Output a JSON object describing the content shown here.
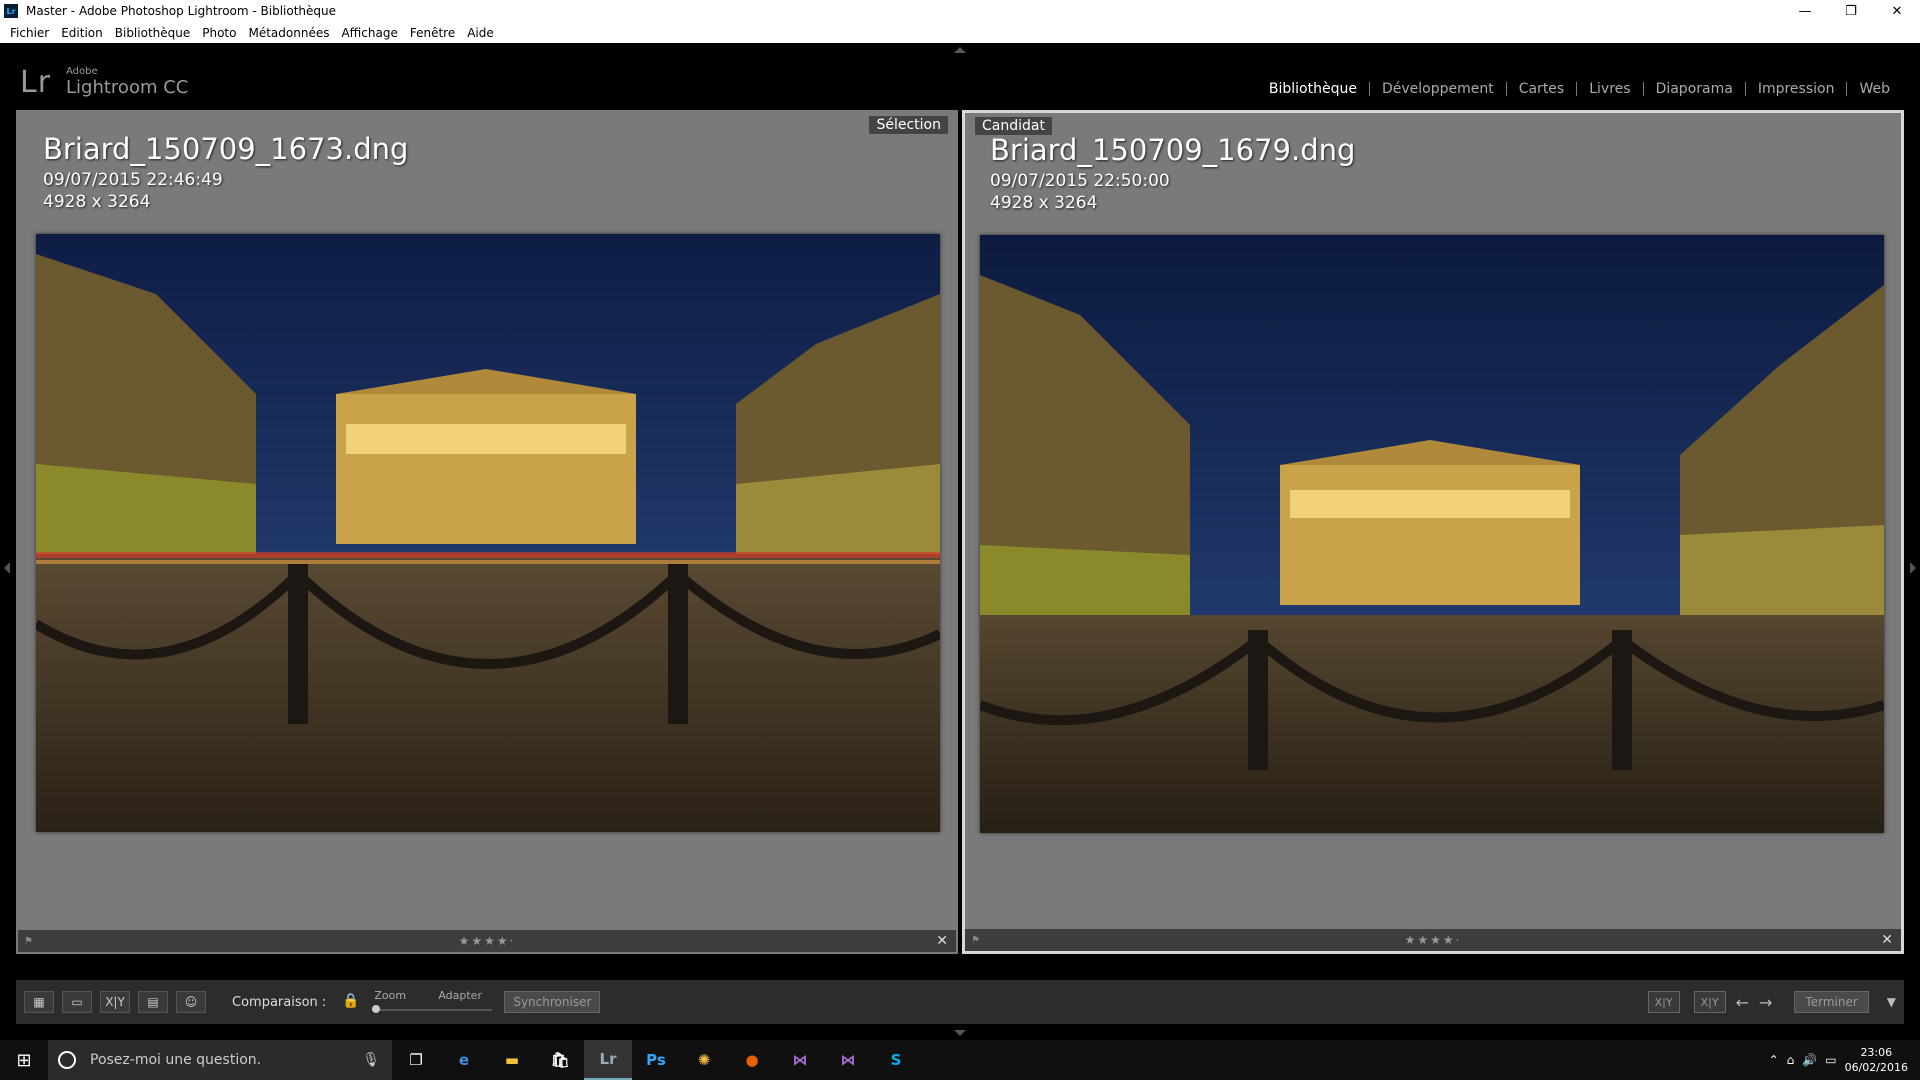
{
  "window": {
    "title": "Master - Adobe Photoshop Lightroom - Bibliothèque",
    "app_badge": "Lr",
    "controls": {
      "minimize": "—",
      "restore": "❐",
      "close": "✕"
    }
  },
  "menu": [
    "Fichier",
    "Edition",
    "Bibliothèque",
    "Photo",
    "Métadonnées",
    "Affichage",
    "Fenêtre",
    "Aide"
  ],
  "identity": {
    "logo": "Lr",
    "adobe": "Adobe",
    "product": "Lightroom CC"
  },
  "modules": [
    {
      "label": "Bibliothèque",
      "active": true
    },
    {
      "label": "Développement",
      "active": false
    },
    {
      "label": "Cartes",
      "active": false
    },
    {
      "label": "Livres",
      "active": false
    },
    {
      "label": "Diaporama",
      "active": false
    },
    {
      "label": "Impression",
      "active": false
    },
    {
      "label": "Web",
      "active": false
    }
  ],
  "left_pane": {
    "tag": "Sélection",
    "filename": "Briard_150709_1673.dng",
    "datetime": "09/07/2015 22:46:49",
    "dimensions": "4928 x 3264",
    "stars": "★★★★·",
    "rating": 4,
    "close": "✕"
  },
  "right_pane": {
    "tag": "Candidat",
    "filename": "Briard_150709_1679.dng",
    "datetime": "09/07/2015 22:50:00",
    "dimensions": "4928 x 3264",
    "stars": "★★★★·",
    "rating": 4,
    "close": "✕"
  },
  "toolbar": {
    "compare_label": "Comparaison :",
    "zoom_label": "Zoom",
    "fit_label": "Adapter",
    "sync_label": "Synchroniser",
    "done_label": "Terminer",
    "xy_label": "X|Y",
    "view_icons": [
      "grid-view-icon",
      "loupe-view-icon",
      "compare-view-icon",
      "survey-view-icon",
      "people-view-icon"
    ]
  },
  "taskbar": {
    "search_placeholder": "Posez-moi une question.",
    "time": "23:06",
    "date": "06/02/2016",
    "apps": [
      "task-view",
      "edge",
      "file-explorer",
      "store",
      "lightroom",
      "photoshop",
      "pinwheel",
      "firefox",
      "visual-studio",
      "visual-studio-blend",
      "skype"
    ],
    "app_glyphs": {
      "lightroom": "Lr",
      "photoshop": "Ps",
      "skype": "S"
    }
  },
  "colors": {
    "selected_border": "#d8d8d8",
    "pane_bg": "#7a7a7a",
    "lightroom_blue": "#31a8ff"
  }
}
